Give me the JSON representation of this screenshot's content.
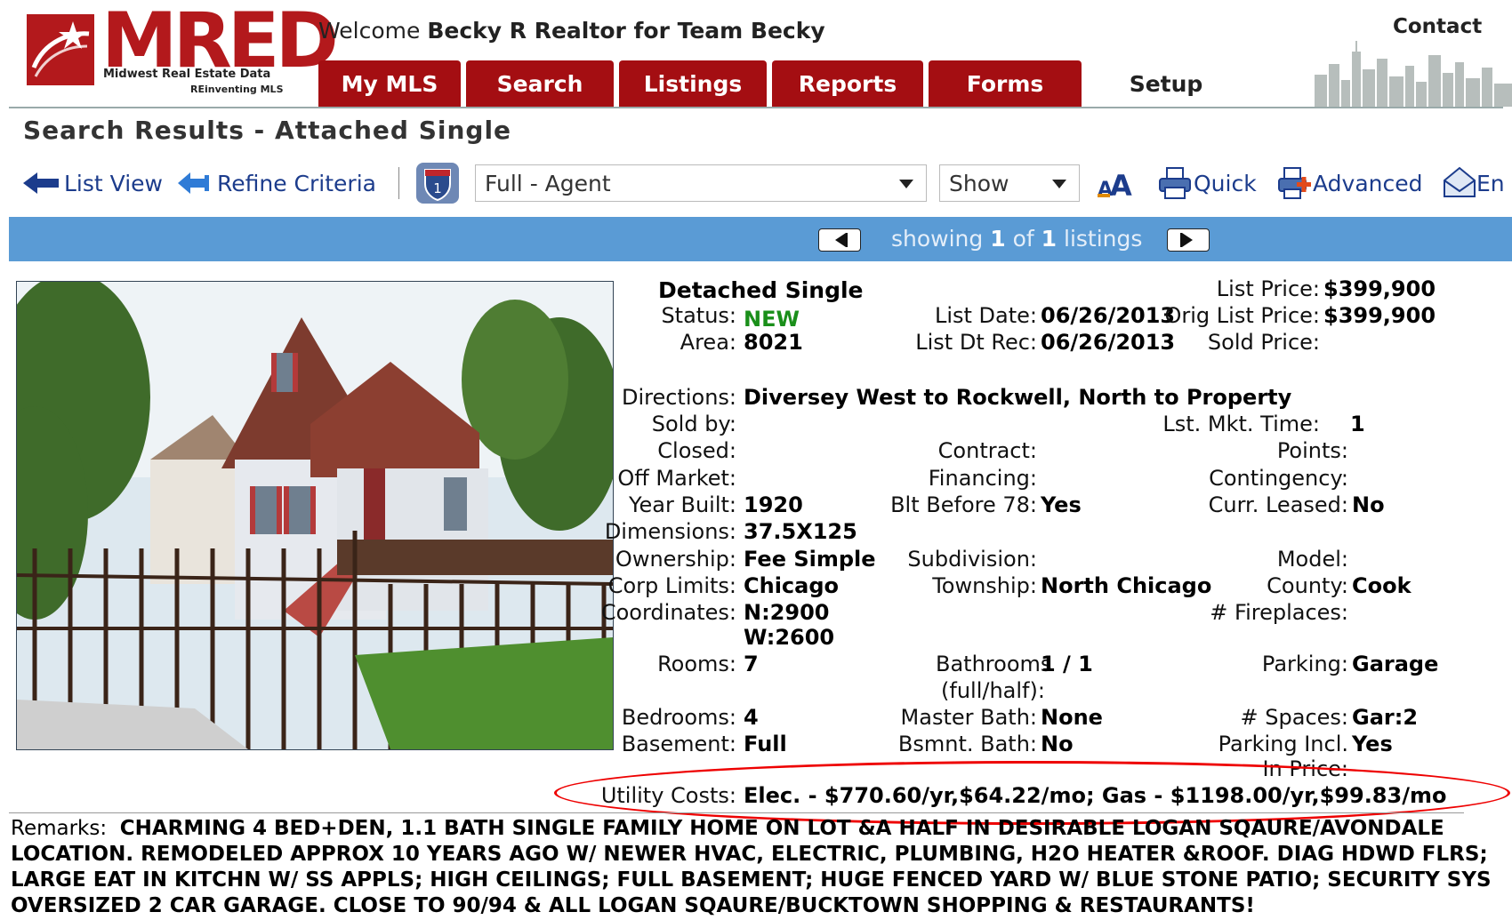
{
  "header": {
    "logo_text": "MRED",
    "logo_subtitle": "Midwest Real Estate Data",
    "logo_tagline": "REinventing MLS",
    "welcome_prefix": "Welcome",
    "welcome_user": "Becky R Realtor for Team Becky",
    "contact_label": "Contact"
  },
  "tabs": [
    {
      "label": "My MLS"
    },
    {
      "label": "Search"
    },
    {
      "label": "Listings"
    },
    {
      "label": "Reports"
    },
    {
      "label": "Forms"
    },
    {
      "label": "Setup",
      "active": true
    }
  ],
  "page_title": "Search Results - Attached Single",
  "toolbar": {
    "list_view": "List View",
    "refine_criteria": "Refine Criteria",
    "report_select": "Full - Agent",
    "show_select": "Show",
    "quick": "Quick",
    "advanced": "Advanced",
    "email_partial": "En"
  },
  "paging": {
    "prefix": "showing",
    "current": "1",
    "middle": "of",
    "total": "1",
    "suffix": "listings"
  },
  "listing": {
    "property_type": "Detached Single",
    "status": {
      "label": "Status:",
      "value": "NEW"
    },
    "area": {
      "label": "Area:",
      "value": "8021"
    },
    "list_date": {
      "label": "List Date:",
      "value": "06/26/2013"
    },
    "list_dt_rec": {
      "label": "List Dt Rec:",
      "value": "06/26/2013"
    },
    "list_price": {
      "label": "List Price:",
      "value": "$399,900"
    },
    "orig_list_price": {
      "label": "Orig List Price:",
      "value": "$399,900"
    },
    "sold_price": {
      "label": "Sold Price:",
      "value": ""
    },
    "directions": {
      "label": "Directions:",
      "value": "Diversey West to Rockwell, North to Property"
    },
    "sold_by": {
      "label": "Sold by:",
      "value": ""
    },
    "lst_mkt_time": {
      "label": "Lst. Mkt. Time:",
      "value": "1"
    },
    "closed": {
      "label": "Closed:",
      "value": ""
    },
    "contract": {
      "label": "Contract:",
      "value": ""
    },
    "points": {
      "label": "Points:",
      "value": ""
    },
    "off_market": {
      "label": "Off Market:",
      "value": ""
    },
    "financing": {
      "label": "Financing:",
      "value": ""
    },
    "contingency": {
      "label": "Contingency:",
      "value": ""
    },
    "year_built": {
      "label": "Year Built:",
      "value": "1920"
    },
    "blt_before_78": {
      "label": "Blt Before 78:",
      "value": "Yes"
    },
    "curr_leased": {
      "label": "Curr. Leased:",
      "value": "No"
    },
    "dimensions": {
      "label": "Dimensions:",
      "value": "37.5X125"
    },
    "ownership": {
      "label": "Ownership:",
      "value": "Fee Simple"
    },
    "subdivision": {
      "label": "Subdivision:",
      "value": ""
    },
    "model": {
      "label": "Model:",
      "value": ""
    },
    "corp_limits": {
      "label": "Corp Limits:",
      "value": "Chicago"
    },
    "township": {
      "label": "Township:",
      "value": "North Chicago"
    },
    "county": {
      "label": "County:",
      "value": "Cook"
    },
    "coordinates": {
      "label": "Coordinates:",
      "value_n": "N:2900",
      "value_w": "W:2600"
    },
    "fireplaces": {
      "label": "# Fireplaces:",
      "value": ""
    },
    "rooms": {
      "label": "Rooms:",
      "value": "7"
    },
    "bathrooms": {
      "label1": "Bathrooms",
      "label2": "(full/half):",
      "value": "1 / 1"
    },
    "parking": {
      "label": "Parking:",
      "value": "Garage"
    },
    "bedrooms": {
      "label": "Bedrooms:",
      "value": "4"
    },
    "master_bath": {
      "label": "Master Bath:",
      "value": "None"
    },
    "spaces": {
      "label": "# Spaces:",
      "value": "Gar:2"
    },
    "basement": {
      "label": "Basement:",
      "value": "Full"
    },
    "bsmnt_bath": {
      "label": "Bsmnt. Bath:",
      "value": "No"
    },
    "parking_incl": {
      "label1": "Parking Incl.",
      "label2": "In Price:",
      "value": "Yes"
    },
    "utility_costs": {
      "label": "Utility Costs:",
      "value": "Elec. - $770.60/yr,$64.22/mo; Gas - $1198.00/yr,$99.83/mo"
    },
    "remarks_label": "Remarks:",
    "remarks_text": "CHARMING 4 BED+DEN, 1.1 BATH SINGLE FAMILY HOME ON LOT &A HALF IN DESIRABLE LOGAN SQAURE/AVONDALE LOCATION. REMODELED APPROX 10 YEARS AGO W/ NEWER HVAC, ELECTRIC, PLUMBING, H2O HEATER &ROOF. DIAG HDWD FLRS; LARGE EAT IN KITCHN W/ SS APPLS; HIGH CEILINGS; FULL BASEMENT; HUGE FENCED YARD W/ BLUE STONE PATIO; SECURITY SYS OVERSIZED 2 CAR GARAGE. CLOSE TO 90/94 & ALL LOGAN SQAURE/BUCKTOWN SHOPPING & RESTAURANTS!"
  },
  "colors": {
    "brand_red": "#a40e12",
    "paging_blue": "#5a9bd5",
    "status_green": "#1a8f1a",
    "highlight_red": "#e00000",
    "link_blue": "#1c3c8c"
  }
}
